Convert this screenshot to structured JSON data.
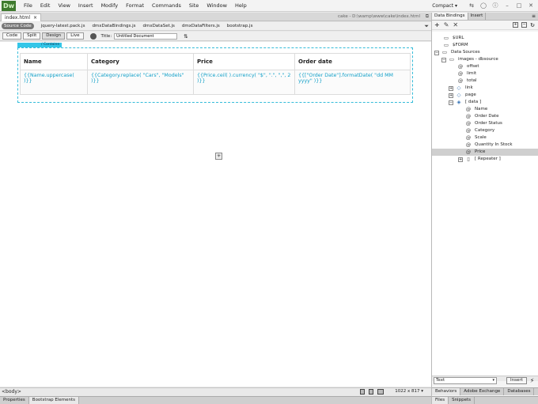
{
  "app": {
    "logo": "Dw"
  },
  "menu": [
    "File",
    "Edit",
    "View",
    "Insert",
    "Modify",
    "Format",
    "Commands",
    "Site",
    "Window",
    "Help"
  ],
  "workspace": "Compact ▾",
  "document": {
    "tab_label": "index.html",
    "path": "cake - D:\\wamp\\www\\cake\\index.html",
    "source_code_label": "Source Code",
    "related_files": [
      "jquery-latest.pack.js",
      "dmxDataBindings.js",
      "dmxDataSet.js",
      "dmxDataFilters.js",
      "bootstrap.js"
    ]
  },
  "view_toolbar": {
    "buttons": [
      "Code",
      "Split",
      "Design",
      "Live"
    ],
    "title_label": "Title:",
    "title_value": "Untitled Document"
  },
  "canvas": {
    "container_label": "/ Containe",
    "table": {
      "headers": [
        "Name",
        "Category",
        "Price",
        "Order date"
      ],
      "row": [
        "{{Name.uppercase( )}}",
        "{{Category.replace( \"Cars\", \"Models\" )}}",
        "{{Price.ceil( ).currency( \"$\", \".\", \",\", 2 )}}",
        "{{[\"Order Date\"].formatDate( \"dd MM yyyy\" )}}"
      ]
    }
  },
  "status": {
    "tag": "<body>",
    "window_size": "1022 x 817 ▾"
  },
  "bottom_tabs": [
    "Properties",
    "Bootstrap Elements"
  ],
  "right_panel": {
    "tabs": [
      "Data Bindings",
      "Insert"
    ],
    "tree": [
      {
        "label": "$URL",
        "indent": 0
      },
      {
        "label": "$FORM",
        "indent": 0
      },
      {
        "label": "Data Sources",
        "indent": 0
      },
      {
        "label": "images - dbsource",
        "indent": 1
      },
      {
        "label": "offset",
        "indent": 2
      },
      {
        "label": "limit",
        "indent": 2
      },
      {
        "label": "total",
        "indent": 2
      },
      {
        "label": "link",
        "indent": 2
      },
      {
        "label": "page",
        "indent": 2
      },
      {
        "label": "[ data ]",
        "indent": 2
      },
      {
        "label": "Name",
        "indent": 3
      },
      {
        "label": "Order Date",
        "indent": 3
      },
      {
        "label": "Order Status",
        "indent": 3
      },
      {
        "label": "Category",
        "indent": 3
      },
      {
        "label": "Scale",
        "indent": 3
      },
      {
        "label": "Quantity In Stock",
        "indent": 3
      },
      {
        "label": "Price",
        "indent": 3
      },
      {
        "label": "[ Repeater ]",
        "indent": 3
      }
    ],
    "text_select": "Text",
    "insert_label": "Insert",
    "bottom_tabs_1": [
      "Behaviors",
      "Adobe Exchange",
      "Databases"
    ],
    "bottom_tabs_2": [
      "Files",
      "Snippets"
    ]
  }
}
